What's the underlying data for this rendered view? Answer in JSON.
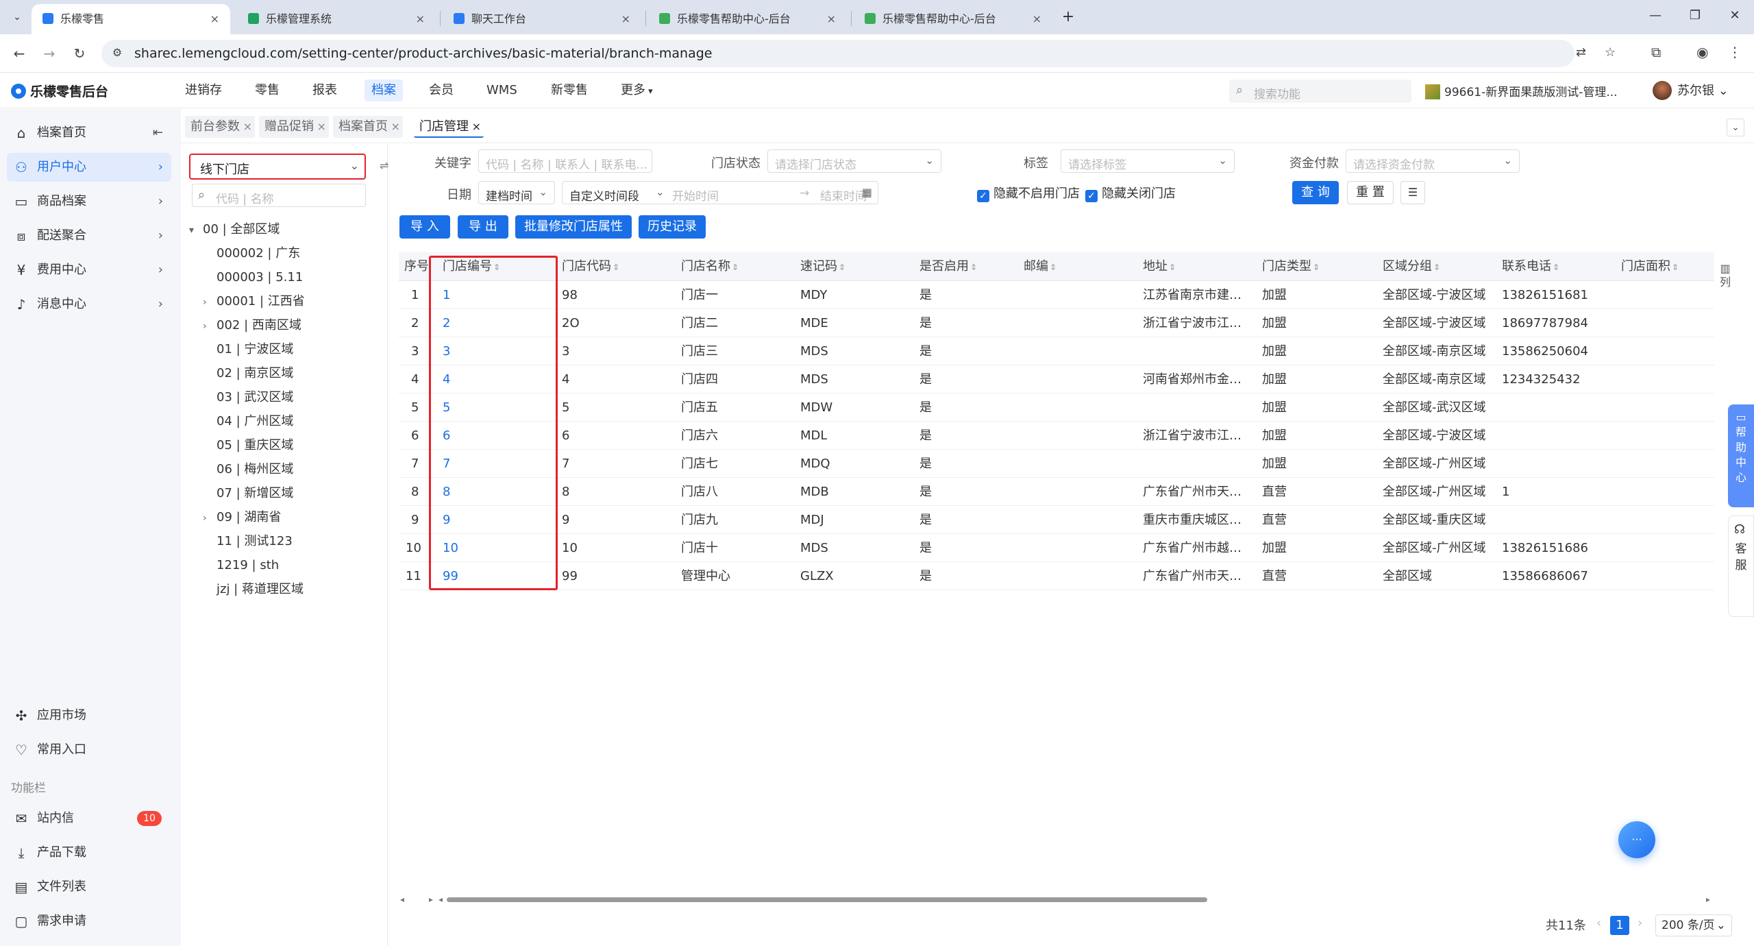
{
  "browser": {
    "tabs": [
      {
        "title": "乐檬零售",
        "active": true,
        "favicon_color": "#2a7bf4"
      },
      {
        "title": "乐檬管理系统",
        "active": false,
        "favicon_color": "#1fa462"
      },
      {
        "title": "聊天工作台",
        "active": false,
        "favicon_color": "#2a7bf4"
      },
      {
        "title": "乐檬零售帮助中心-后台",
        "active": false,
        "favicon_color": "#3cae5a"
      },
      {
        "title": "乐檬零售帮助中心-后台",
        "active": false,
        "favicon_color": "#3cae5a"
      }
    ],
    "tab_close": "×",
    "new_tab": "+",
    "url": "sharec.lemengcloud.com/setting-center/product-archives/basic-material/branch-manage"
  },
  "app": {
    "logo_text": "乐檬零售后台",
    "nav": [
      {
        "label": "进销存",
        "active": false
      },
      {
        "label": "零售",
        "active": false
      },
      {
        "label": "报表",
        "active": false
      },
      {
        "label": "档案",
        "active": true
      },
      {
        "label": "会员",
        "active": false
      },
      {
        "label": "WMS",
        "active": false
      },
      {
        "label": "新零售",
        "active": false
      },
      {
        "label": "更多",
        "active": false
      }
    ],
    "search_placeholder": "搜索功能",
    "tenant": "99661-新界面果蔬版测试-管理...",
    "user_name": "苏尔银"
  },
  "sidebar": {
    "items": [
      {
        "label": "档案首页",
        "icon": "home-icon",
        "active": false,
        "arrow": "collapse"
      },
      {
        "label": "用户中心",
        "icon": "user-icon",
        "active": true,
        "arrow": "chevron"
      },
      {
        "label": "商品档案",
        "icon": "box-icon",
        "active": false,
        "arrow": "chevron"
      },
      {
        "label": "配送聚合",
        "icon": "delivery-icon",
        "active": false,
        "arrow": "chevron"
      },
      {
        "label": "费用中心",
        "icon": "yen-icon",
        "active": false,
        "arrow": "chevron"
      },
      {
        "label": "消息中心",
        "icon": "bell-icon",
        "active": false,
        "arrow": "chevron"
      }
    ],
    "bottom_items": [
      {
        "label": "应用市场",
        "icon": "app-market-icon"
      },
      {
        "label": "常用入口",
        "icon": "heart-icon"
      }
    ],
    "section_label": "功能栏",
    "func_items": [
      {
        "label": "站内信",
        "icon": "mail-icon",
        "badge": "10"
      },
      {
        "label": "产品下载",
        "icon": "download-icon",
        "badge": ""
      },
      {
        "label": "文件列表",
        "icon": "file-list-icon",
        "badge": ""
      },
      {
        "label": "需求申请",
        "icon": "request-icon",
        "badge": ""
      }
    ]
  },
  "page_tabs": [
    {
      "label": "前台参数",
      "active": false
    },
    {
      "label": "赠品促销",
      "active": false
    },
    {
      "label": "档案首页",
      "active": false
    },
    {
      "label": "门店管理",
      "active": true
    }
  ],
  "tree": {
    "store_type": "线下门店",
    "search_placeholder": "代码 | 名称",
    "nodes": [
      {
        "label": "00 | 全部区域",
        "level": 0,
        "expander": "▾"
      },
      {
        "label": "000002 | 广东",
        "level": 1,
        "expander": ""
      },
      {
        "label": "000003 | 5.11",
        "level": 1,
        "expander": ""
      },
      {
        "label": "00001 | 江西省",
        "level": 1,
        "expander": "›"
      },
      {
        "label": "002 | 西南区域",
        "level": 1,
        "expander": "›"
      },
      {
        "label": "01 | 宁波区域",
        "level": 1,
        "expander": ""
      },
      {
        "label": "02 | 南京区域",
        "level": 1,
        "expander": ""
      },
      {
        "label": "03 | 武汉区域",
        "level": 1,
        "expander": ""
      },
      {
        "label": "04 | 广州区域",
        "level": 1,
        "expander": ""
      },
      {
        "label": "05 | 重庆区域",
        "level": 1,
        "expander": ""
      },
      {
        "label": "06 | 梅州区域",
        "level": 1,
        "expander": ""
      },
      {
        "label": "07 | 新增区域",
        "level": 1,
        "expander": ""
      },
      {
        "label": "09 | 湖南省",
        "level": 1,
        "expander": "›"
      },
      {
        "label": "11 | 测试123",
        "level": 1,
        "expander": ""
      },
      {
        "label": "1219 | sth",
        "level": 1,
        "expander": ""
      },
      {
        "label": "jzj | 蒋道理区域",
        "level": 1,
        "expander": ""
      }
    ]
  },
  "filters": {
    "keyword_label": "关键字",
    "keyword_placeholder": "代码 | 名称 | 联系人 | 联系电...",
    "status_label": "门店状态",
    "status_placeholder": "请选择门店状态",
    "tag_label": "标签",
    "tag_placeholder": "请选择标签",
    "fund_label": "资金付款",
    "fund_placeholder": "请选择资金付款",
    "date_label": "日期",
    "date_type": "建档时间",
    "date_range_type": "自定义时间段",
    "start_placeholder": "开始时间",
    "date_arrow": "→",
    "end_placeholder": "结束时间",
    "hide_disabled": "隐藏不启用门店",
    "hide_closed": "隐藏关闭门店",
    "query_btn": "查 询",
    "reset_btn": "重 置"
  },
  "actions": {
    "import": "导 入",
    "export": "导 出",
    "batch_modify": "批量修改门店属性",
    "history": "历史记录"
  },
  "table": {
    "columns": [
      "序号",
      "门店编号",
      "门店代码",
      "门店名称",
      "速记码",
      "是否启用",
      "邮编",
      "地址",
      "门店类型",
      "区域分组",
      "联系电话",
      "门店面积"
    ],
    "rows": [
      [
        "1",
        "1",
        "98",
        "门店一",
        "MDY",
        "是",
        "",
        "江苏省南京市建…",
        "加盟",
        "全部区域-宁波区域",
        "13826151681",
        ""
      ],
      [
        "2",
        "2",
        "2O",
        "门店二",
        "MDE",
        "是",
        "",
        "浙江省宁波市江…",
        "加盟",
        "全部区域-宁波区域",
        "18697787984",
        ""
      ],
      [
        "3",
        "3",
        "3",
        "门店三",
        "MDS",
        "是",
        "",
        "",
        "加盟",
        "全部区域-南京区域",
        "13586250604",
        ""
      ],
      [
        "4",
        "4",
        "4",
        "门店四",
        "MDS",
        "是",
        "",
        "河南省郑州市金…",
        "加盟",
        "全部区域-南京区域",
        "1234325432",
        ""
      ],
      [
        "5",
        "5",
        "5",
        "门店五",
        "MDW",
        "是",
        "",
        "",
        "加盟",
        "全部区域-武汉区域",
        "",
        ""
      ],
      [
        "6",
        "6",
        "6",
        "门店六",
        "MDL",
        "是",
        "",
        "浙江省宁波市江…",
        "加盟",
        "全部区域-宁波区域",
        "",
        ""
      ],
      [
        "7",
        "7",
        "7",
        "门店七",
        "MDQ",
        "是",
        "",
        "",
        "加盟",
        "全部区域-广州区域",
        "",
        ""
      ],
      [
        "8",
        "8",
        "8",
        "门店八",
        "MDB",
        "是",
        "",
        "广东省广州市天…",
        "直营",
        "全部区域-广州区域",
        "1",
        ""
      ],
      [
        "9",
        "9",
        "9",
        "门店九",
        "MDJ",
        "是",
        "",
        "重庆市重庆城区…",
        "直营",
        "全部区域-重庆区域",
        "",
        ""
      ],
      [
        "10",
        "10",
        "10",
        "门店十",
        "MDS",
        "是",
        "",
        "广东省广州市越…",
        "加盟",
        "全部区域-广州区域",
        "13826151686",
        ""
      ],
      [
        "11",
        "99",
        "99",
        "管理中心",
        "GLZX",
        "是",
        "",
        "广东省广州市天…",
        "直营",
        "全部区域",
        "13586686067",
        ""
      ]
    ],
    "column_settings": "列"
  },
  "pager": {
    "total": "共11条",
    "current": "1",
    "page_size": "200 条/页"
  },
  "floating": {
    "help": "帮助中心",
    "service": "客服"
  },
  "colors": {
    "primary": "#1a6fe6",
    "highlight": "#e3232c",
    "badge": "#f5483b"
  }
}
